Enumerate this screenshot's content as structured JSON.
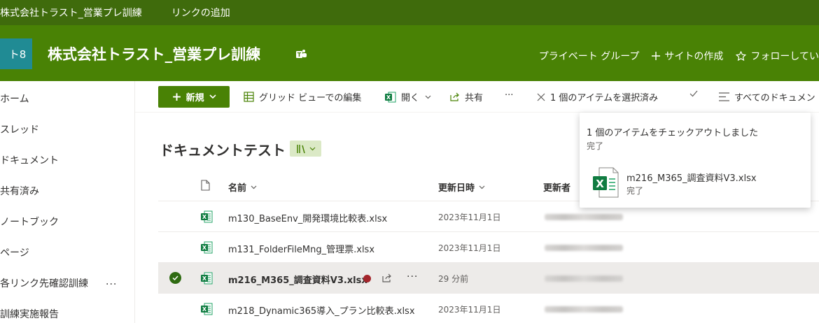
{
  "topbar": {
    "site_link": "株式会社トラスト_営業プレ訓練",
    "add_link": "リンクの追加"
  },
  "header": {
    "logo_text": "ト8",
    "title": "株式会社トラスト_営業プレ訓練",
    "private_group": "プライベート グループ",
    "create_site": "サイトの作成",
    "follow": "フォローしてい"
  },
  "nav": {
    "items": [
      "ホーム",
      "スレッド",
      "ドキュメント",
      "共有済み",
      "ノートブック",
      "ページ",
      "各リンク先確認訓練",
      "訓練実施報告"
    ],
    "more": "..."
  },
  "commandbar": {
    "new_label": "新規",
    "grid_edit": "グリッド ビューでの編集",
    "open": "開く",
    "share": "共有",
    "more": "···",
    "selected": "1 個のアイテムを選択済み",
    "all_docs": "すべてのドキュメン"
  },
  "library": {
    "title": "ドキュメントテスト",
    "columns": {
      "name": "名前",
      "modified": "更新日時",
      "modified_by": "更新者"
    },
    "rows": [
      {
        "name": "m130_BaseEnv_開発環境比較表.xlsx",
        "modified": "2023年11月1日"
      },
      {
        "name": "m131_FolderFileMng_管理票.xlsx",
        "modified": "2023年11月1日"
      },
      {
        "name": "m216_M365_調査資料V3.xlsx",
        "modified": "29 分前",
        "selected": true
      },
      {
        "name": "m218_Dynamic365導入_プラン比較表.xlsx",
        "modified": "2023年11月1日"
      }
    ],
    "row_more": "···"
  },
  "toast": {
    "message": "1 個のアイテムをチェックアウトしました",
    "status": "完了",
    "file_name": "m216_M365_調査資料V3.xlsx",
    "file_status": "完了"
  },
  "colors": {
    "topbar": "#3f6b0c",
    "header": "#498205",
    "logo": "#208b94",
    "accent": "#498205"
  }
}
